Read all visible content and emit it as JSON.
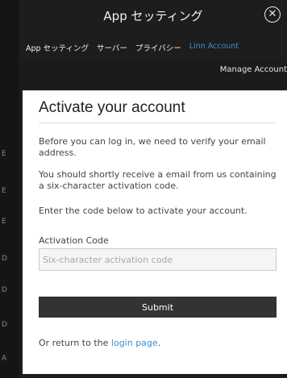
{
  "window": {
    "title": "App セッティング",
    "close_glyph": "✕"
  },
  "tabs": [
    {
      "label": "App セッティング",
      "active": false
    },
    {
      "label": "サーバー",
      "active": false
    },
    {
      "label": "プライバシー",
      "active": false
    },
    {
      "label": "Linn Account",
      "active": true
    }
  ],
  "subbar": {
    "manage_label": "Manage Account"
  },
  "left_marks": [
    "E",
    "E",
    "E",
    "D",
    "D",
    "D",
    "A"
  ],
  "form": {
    "heading": "Activate your account",
    "para1": "Before you can log in, we need to verify your email address.",
    "para2": "You should shortly receive a email from us containing a six-character activation code.",
    "para3": "Enter the code below to activate your account.",
    "code_label": "Activation Code",
    "code_placeholder": "Six-character activation code",
    "code_value": "",
    "submit_label": "Submit",
    "return_prefix": "Or return to the ",
    "return_link": "login page",
    "return_suffix": "."
  },
  "colors": {
    "accent": "#3b8fd1",
    "button_bg": "#333333",
    "backdrop": "#1d1d1d"
  },
  "icons": {
    "close": "close-icon"
  }
}
